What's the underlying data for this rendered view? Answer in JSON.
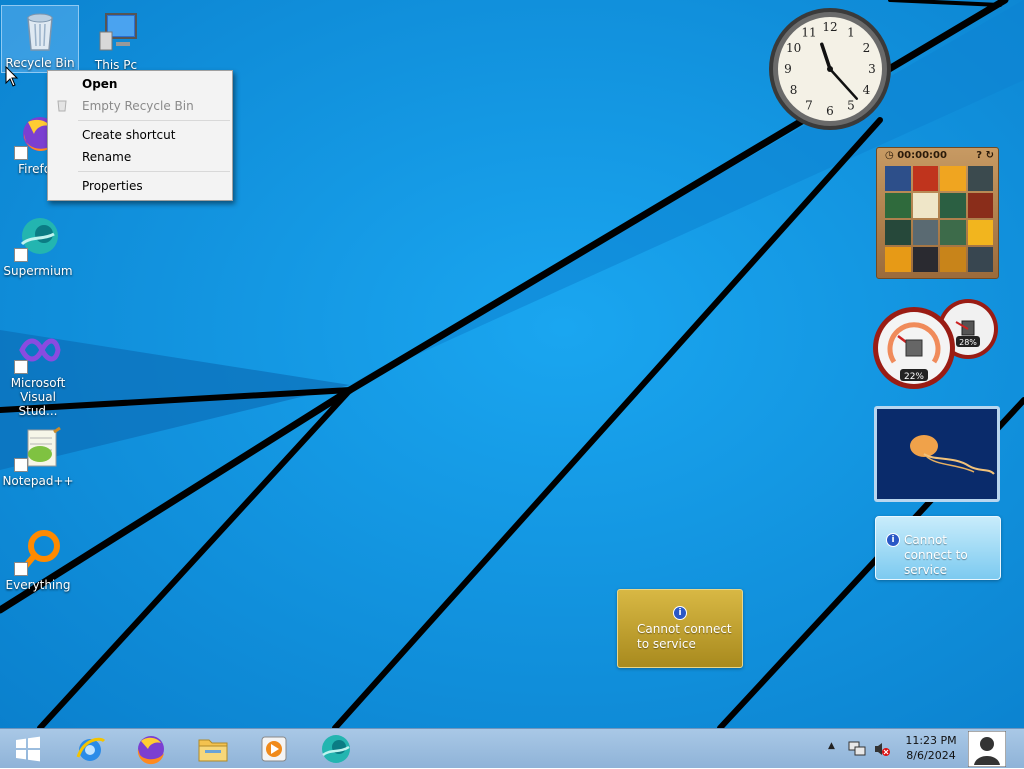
{
  "desktop": {
    "icons": [
      {
        "label": "Recycle Bin",
        "icon": "recycle-bin-icon"
      },
      {
        "label": "This Pc",
        "icon": "computer-icon"
      },
      {
        "label": "Firefox",
        "icon": "firefox-icon"
      },
      {
        "label": "Supermium",
        "icon": "supermium-icon"
      },
      {
        "label": "Microsoft Visual Stud...",
        "icon": "visual-studio-icon"
      },
      {
        "label": "Notepad++",
        "icon": "notepad-plus-plus-icon"
      },
      {
        "label": "Everything",
        "icon": "everything-icon"
      }
    ]
  },
  "context_menu": {
    "items": [
      {
        "label": "Open",
        "bold": true
      },
      {
        "label": "Empty Recycle Bin",
        "disabled": true
      },
      {
        "label": "Create shortcut"
      },
      {
        "label": "Rename"
      },
      {
        "label": "Properties"
      }
    ]
  },
  "gadgets": {
    "clock": {
      "hour": 11,
      "minute": 23,
      "numerals": [
        "12",
        "1",
        "2",
        "3",
        "4",
        "5",
        "6",
        "7",
        "8",
        "9",
        "10",
        "11"
      ]
    },
    "puzzle": {
      "timer": "00:00:00"
    },
    "cpu_meter": {
      "cpu_percent": "22%",
      "memory_percent": "28%"
    },
    "weather_blue": {
      "message": "Cannot connect to service"
    },
    "weather_gold": {
      "message": "Cannot connect to service"
    }
  },
  "taskbar": {
    "pinned": [
      "start-button",
      "internet-explorer-icon",
      "firefox-icon",
      "file-explorer-icon",
      "media-player-icon",
      "supermium-icon"
    ],
    "tray": {
      "time": "11:23 PM",
      "date": "8/6/2024"
    }
  },
  "colors": {
    "wallpaper": "#0f8fdc",
    "taskbar": "#a9c8e6",
    "menu_bg": "#f3f3f3"
  }
}
